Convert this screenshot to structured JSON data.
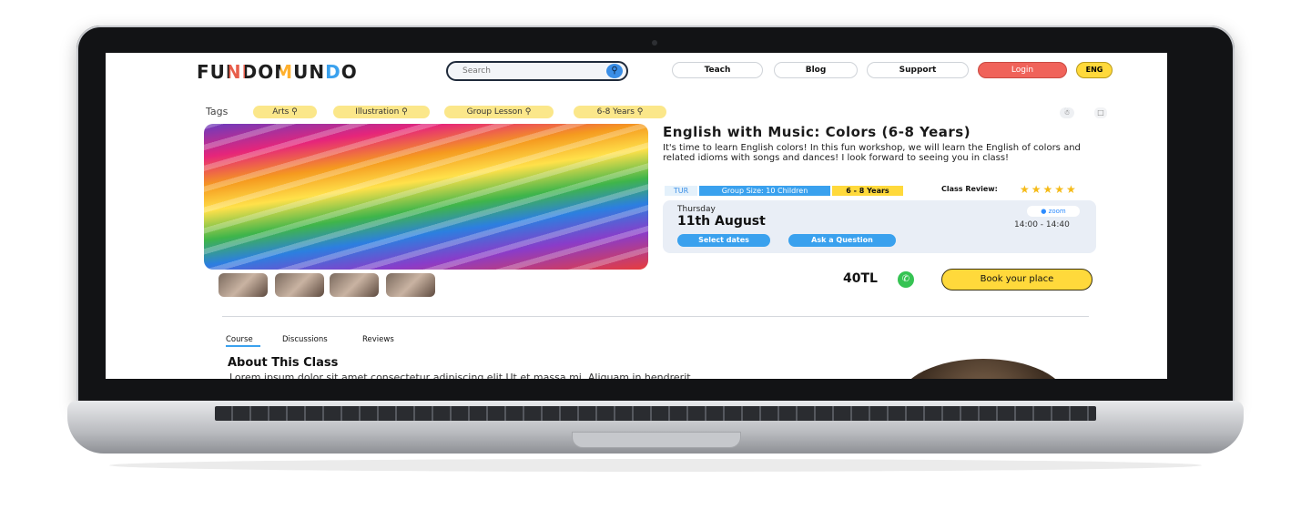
{
  "header": {
    "logo": "FUNDOMUNDO",
    "search_placeholder": "Search",
    "nav": [
      "Teach",
      "Blog",
      "Support"
    ],
    "login": "Login",
    "language": "ENG"
  },
  "tags": {
    "label": "Tags",
    "items": [
      "Arts",
      "Illustration",
      "Group Lesson",
      "6-8 Years"
    ]
  },
  "course": {
    "title": "English with Music: Colors (6-8 Years)",
    "description": "It's time to learn English colors! In this fun workshop, we will learn the English of colors and related idioms with songs and dances! I look forward to seeing you in class!",
    "language_chip": "TUR",
    "group_size": "Group Size: 10 Children",
    "age_range": "6 - 8  Years",
    "review_label": "Class Review:",
    "rating": 5,
    "stars": "★★★★★"
  },
  "schedule": {
    "day": "Thursday",
    "date": "11th August",
    "platform": "zoom",
    "time": "14:00 - 14:40",
    "select_dates": "Select dates",
    "ask_question": "Ask a Question"
  },
  "purchase": {
    "price": "40TL",
    "book_label": "Book your place"
  },
  "tabs": [
    "Course",
    "Discussions",
    "Reviews"
  ],
  "about": {
    "heading": "About This Class",
    "text": "Lorem ipsum dolor sit amet consectetur adipiscing elit Ut et massa mi. Aliquam in hendrerit"
  },
  "colors": {
    "accent_yellow": "#ffd93b",
    "login_red": "#f0635a",
    "accent_blue": "#3aa1ee",
    "star_gold": "#f5bb19"
  }
}
